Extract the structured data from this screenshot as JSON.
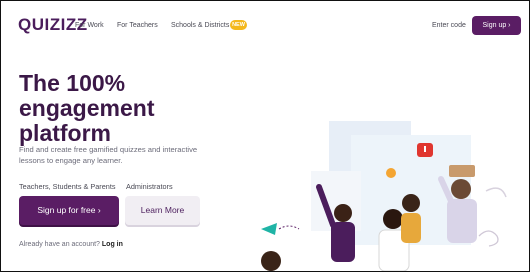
{
  "nav": {
    "logo": "QUIZIZZ",
    "links": [
      "For Work",
      "For Teachers",
      "Schools & Districts"
    ],
    "new_badge": "NEW",
    "enter_code": "Enter code",
    "signup": "Sign up ›"
  },
  "hero": {
    "title_line1": "The 100%",
    "title_line2": "engagement",
    "title_line3": "platform",
    "subtitle": "Find and create free gamified quizzes and interactive lessons to engage any learner.",
    "tabs": [
      "Teachers, Students & Parents",
      "Administrators"
    ],
    "primary_cta": "Sign up for free ›",
    "secondary_cta": "Learn More",
    "login_prompt": "Already have an account?",
    "login_link": "Log in"
  },
  "colors": {
    "brand_purple": "#5a1d64",
    "title_purple": "#3b1847",
    "badge_yellow": "#f4b81c",
    "accent_red": "#e0362f",
    "accent_teal": "#1fb4a6"
  },
  "icons": [
    "chevron-right-icon",
    "chat-bubble-icon",
    "star-icon",
    "paper-plane-icon"
  ]
}
